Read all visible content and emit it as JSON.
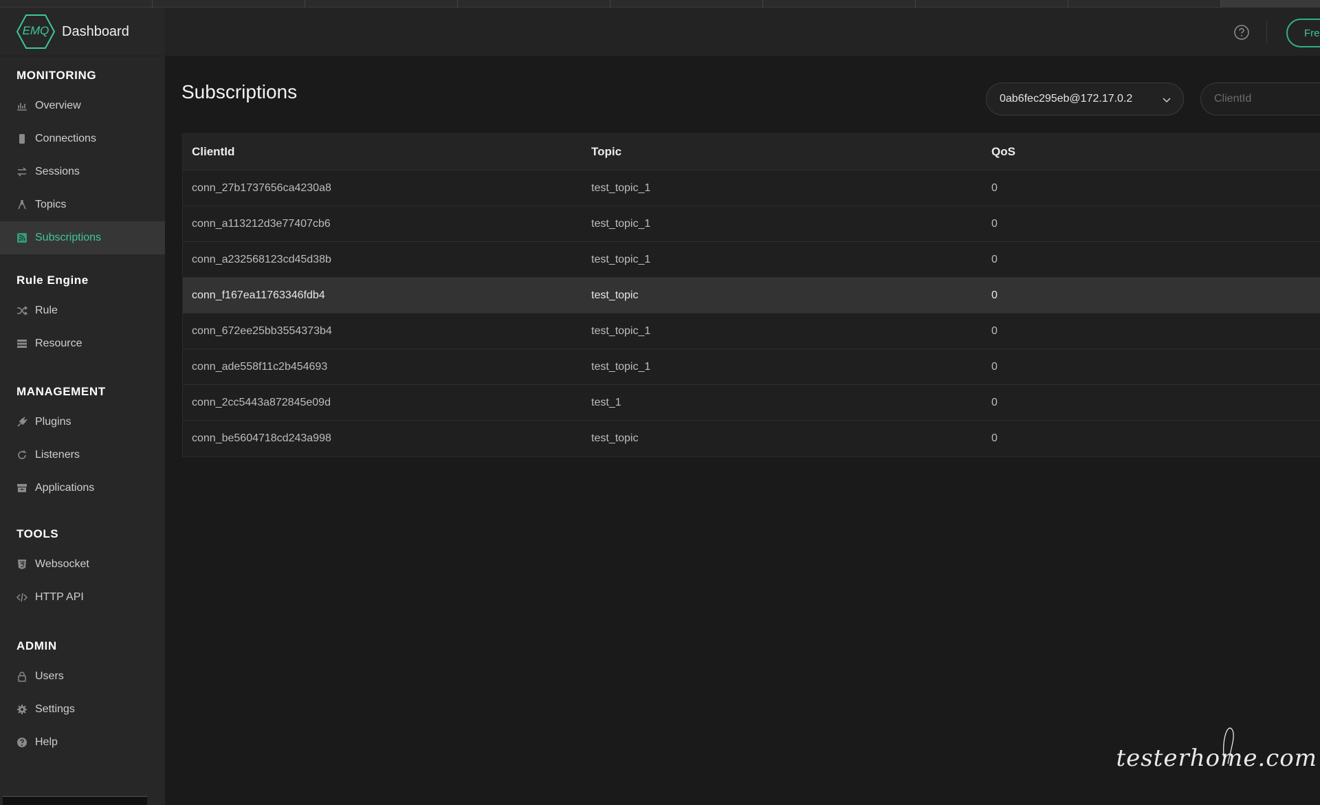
{
  "brand": {
    "logo_text": "EMQ",
    "title": "Dashboard"
  },
  "sidebar": {
    "sections": [
      {
        "title": "MONITORING",
        "items": [
          {
            "label": "Overview",
            "icon": "bar-chart-icon"
          },
          {
            "label": "Connections",
            "icon": "phone-icon"
          },
          {
            "label": "Sessions",
            "icon": "swap-arrows-icon"
          },
          {
            "label": "Topics",
            "icon": "branch-icon"
          },
          {
            "label": "Subscriptions",
            "icon": "rss-icon",
            "active": true
          }
        ]
      },
      {
        "title": "Rule Engine",
        "items": [
          {
            "label": "Rule",
            "icon": "shuffle-icon"
          },
          {
            "label": "Resource",
            "icon": "server-icon"
          }
        ]
      },
      {
        "title": "MANAGEMENT",
        "items": [
          {
            "label": "Plugins",
            "icon": "plug-icon"
          },
          {
            "label": "Listeners",
            "icon": "refresh-icon"
          },
          {
            "label": "Applications",
            "icon": "archive-icon"
          }
        ]
      },
      {
        "title": "TOOLS",
        "items": [
          {
            "label": "Websocket",
            "icon": "html5-icon"
          },
          {
            "label": "HTTP API",
            "icon": "code-icon"
          }
        ]
      },
      {
        "title": "ADMIN",
        "items": [
          {
            "label": "Users",
            "icon": "lock-icon"
          },
          {
            "label": "Settings",
            "icon": "gear-icon"
          },
          {
            "label": "Help",
            "icon": "question-icon"
          }
        ]
      }
    ]
  },
  "header": {
    "free_button_label": "Fre"
  },
  "main": {
    "title": "Subscriptions",
    "node_select_value": "0ab6fec295eb@172.17.0.2",
    "clientid_placeholder": "ClientId",
    "table": {
      "columns": [
        "ClientId",
        "Topic",
        "QoS"
      ],
      "rows": [
        {
          "clientid": "conn_27b1737656ca4230a8",
          "topic": "test_topic_1",
          "qos": "0"
        },
        {
          "clientid": "conn_a113212d3e77407cb6",
          "topic": "test_topic_1",
          "qos": "0"
        },
        {
          "clientid": "conn_a232568123cd45d38b",
          "topic": "test_topic_1",
          "qos": "0"
        },
        {
          "clientid": "conn_f167ea11763346fdb4",
          "topic": "test_topic",
          "qos": "0",
          "highlight": true
        },
        {
          "clientid": "conn_672ee25bb3554373b4",
          "topic": "test_topic_1",
          "qos": "0"
        },
        {
          "clientid": "conn_ade558f11c2b454693",
          "topic": "test_topic_1",
          "qos": "0"
        },
        {
          "clientid": "conn_2cc5443a872845e09d",
          "topic": "test_1",
          "qos": "0"
        },
        {
          "clientid": "conn_be5604718cd243a998",
          "topic": "test_topic",
          "qos": "0"
        }
      ]
    }
  },
  "watermark": "testerhome.com",
  "colors": {
    "accent": "#3ec79a",
    "sidebar_bg": "#272727",
    "main_bg": "#1a1a1a"
  }
}
